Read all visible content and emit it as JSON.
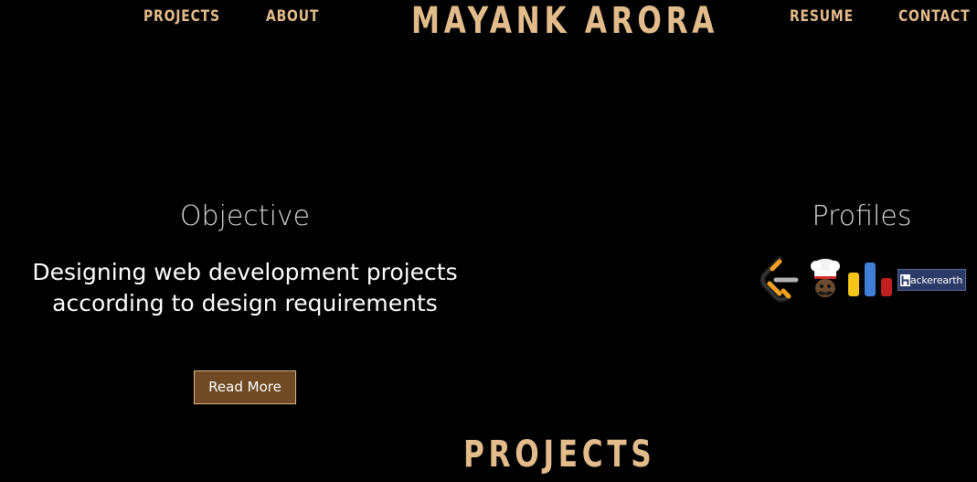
{
  "header": {
    "nav_left": [
      {
        "label": "PROJECTS"
      },
      {
        "label": "ABOUT"
      }
    ],
    "brand": "MAYANK ARORA",
    "nav_right": [
      {
        "label": "RESUME"
      },
      {
        "label": "CONTACT"
      }
    ]
  },
  "objective": {
    "heading": "Objective",
    "text_line_1": "Designing web development projects",
    "text_line_2": "according to design requirements",
    "button_label": "Read More"
  },
  "profiles": {
    "heading": "Profiles",
    "icons": [
      {
        "name": "leetcode-icon"
      },
      {
        "name": "codechef-icon"
      },
      {
        "name": "codeforces-icon"
      },
      {
        "name": "hackerearth-icon",
        "label": "hackerearth"
      }
    ]
  },
  "projects": {
    "title": "PROJECTS"
  },
  "colors": {
    "background": "#000000",
    "accent": "#e2bc8b",
    "button_bg": "#6f4a24",
    "heading": "#d5d5d5",
    "hackerearth_bg": "#2b3a67"
  }
}
